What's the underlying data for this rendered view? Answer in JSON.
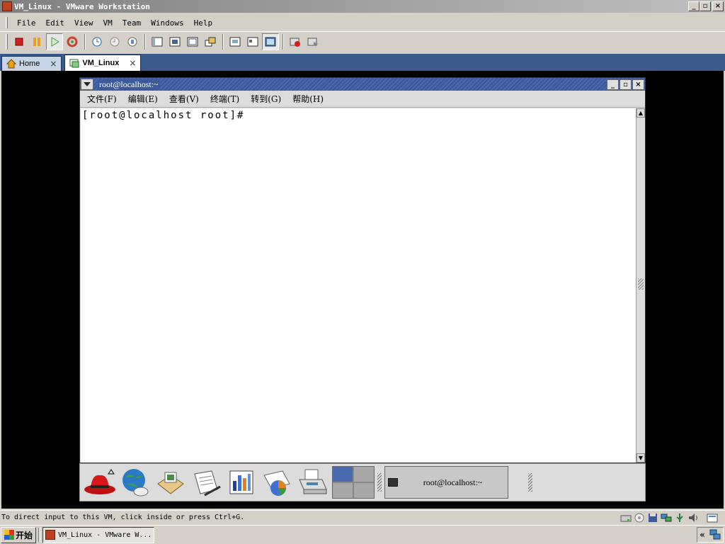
{
  "window": {
    "title": "VM_Linux - VMware Workstation",
    "minimize": "_",
    "restore": "▫",
    "close": "×"
  },
  "menubar": {
    "items": [
      "File",
      "Edit",
      "View",
      "VM",
      "Team",
      "Windows",
      "Help"
    ]
  },
  "tabs": [
    {
      "label": "Home",
      "close": "×"
    },
    {
      "label": "VM_Linux",
      "close": "×"
    }
  ],
  "guest": {
    "window_title": "root@localhost:~",
    "menu": [
      "文件(F)",
      "编辑(E)",
      "查看(V)",
      "终端(T)",
      "转到(G)",
      "帮助(H)"
    ],
    "prompt": "[root@localhost root]#",
    "taskbar_label": "root@localhost:~"
  },
  "status": {
    "text": "To direct input to this VM, click inside or press Ctrl+G."
  },
  "taskbar": {
    "start": "开始",
    "task_label": "VM_Linux - VMware W...",
    "tray_chevron": "«"
  },
  "colors": {
    "tab_strip": "#3a5a8c",
    "guest_title": "#3a5a9a",
    "console_bg": "#000000"
  }
}
